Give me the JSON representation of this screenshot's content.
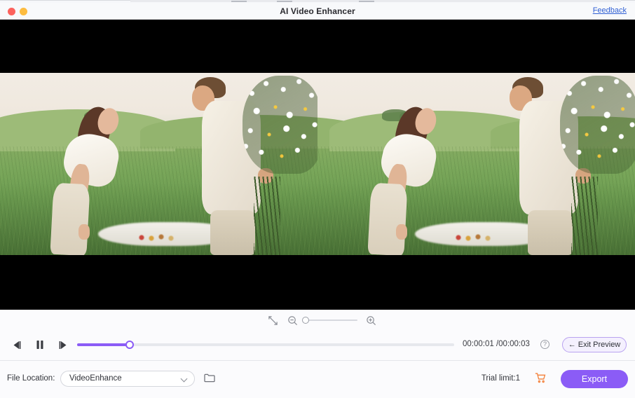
{
  "window": {
    "title": "AI Video Enhancer",
    "feedback_label": "Feedback",
    "traffic_lights": [
      "close-red",
      "minimize-yellow"
    ]
  },
  "preview": {
    "description": "Side-by-side before/after video preview of a couple standing in a green meadow; the man holds a large bouquet of white daisies behind his back.",
    "left_pane_name": "original-video",
    "right_pane_name": "enhanced-video",
    "letterbox_color": "#000000"
  },
  "zoom_toolbar": {
    "fit_icon": "fit-to-screen-icon",
    "zoom_out_icon": "zoom-out-icon",
    "zoom_in_icon": "zoom-in-icon",
    "slider_value": 0,
    "slider_min": 0,
    "slider_max": 100
  },
  "transport": {
    "prev_frame_icon": "previous-frame-icon",
    "play_pause_icon": "pause-icon",
    "next_frame_icon": "next-frame-icon",
    "progress_percent": 14,
    "current_time": "00:00:01",
    "total_time": "00:00:03",
    "time_display": "00:00:01 /00:00:03",
    "help_icon": "help-icon",
    "help_glyph": "?",
    "exit_preview_label": "Exit Preview",
    "exit_preview_arrow": "←",
    "accent_color": "#8b5cf6"
  },
  "bottom_bar": {
    "file_location_label": "File Location:",
    "file_location_value": "VideoEnhance",
    "folder_icon": "folder-icon",
    "trial_text": "Trial limit:1",
    "cart_icon": "shopping-cart-icon",
    "cart_color": "#f4803a",
    "export_label": "Export",
    "export_color": "#8b5cf6"
  }
}
